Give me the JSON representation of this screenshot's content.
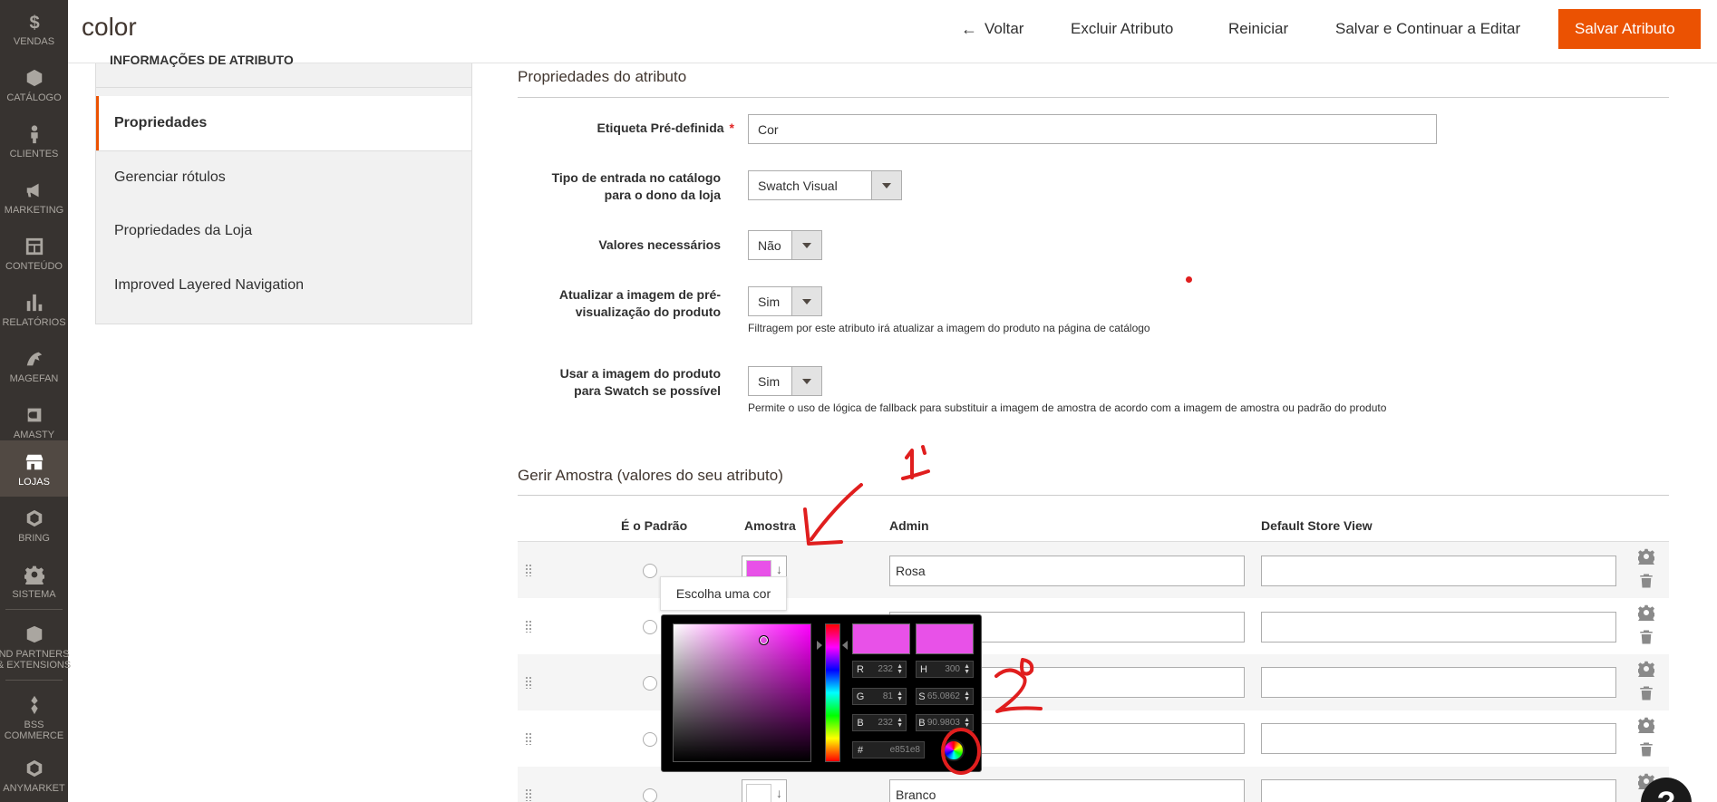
{
  "header": {
    "title": "color",
    "back_label": "Voltar",
    "delete_label": "Excluir Atributo",
    "reset_label": "Reiniciar",
    "save_continue_label": "Salvar e Continuar a Editar",
    "save_label": "Salvar Atributo"
  },
  "sidebar": {
    "items": [
      {
        "label": "VENDAS",
        "icon": "dollar-icon"
      },
      {
        "label": "CATÁLOGO",
        "icon": "cube-icon"
      },
      {
        "label": "CLIENTES",
        "icon": "person-icon"
      },
      {
        "label": "MARKETING",
        "icon": "megaphone-icon"
      },
      {
        "label": "CONTEÚDO",
        "icon": "layout-icon"
      },
      {
        "label": "RELATÓRIOS",
        "icon": "bar-chart-icon"
      },
      {
        "label": "MAGEFAN",
        "icon": "magefan-icon"
      },
      {
        "label": "AMASTY",
        "icon": "amasty-icon"
      },
      {
        "label": "LOJAS",
        "icon": "store-icon"
      },
      {
        "label": "BRING",
        "icon": "hexagon-icon"
      },
      {
        "label": "SISTEMA",
        "icon": "gear-icon"
      },
      {
        "label": "ND PARTNERS\n& EXTENSIONS",
        "icon": "box-icon"
      },
      {
        "label": "BSS\nCOMMERCE",
        "icon": "bss-icon"
      },
      {
        "label": "ANYMARKET",
        "icon": "hexagon-icon"
      }
    ],
    "active": "LOJAS"
  },
  "tabs": {
    "heading": "INFORMAÇÕES DE ATRIBUTO",
    "items": [
      "Propriedades",
      "Gerenciar rótulos",
      "Propriedades da Loja",
      "Improved Layered Navigation"
    ],
    "active": "Propriedades"
  },
  "properties": {
    "section_title": "Propriedades do atributo",
    "default_label": {
      "label": "Etiqueta Pré-definida",
      "value": "Cor"
    },
    "input_type": {
      "label_line1": "Tipo de entrada no catálogo",
      "label_line2": "para o dono da loja",
      "value": "Swatch Visual"
    },
    "required": {
      "label": "Valores necessários",
      "value": "Não"
    },
    "update_preview": {
      "label_line1": "Atualizar a imagem de pré-",
      "label_line2": "visualização do produto",
      "value": "Sim",
      "note": "Filtragem por este atributo irá atualizar a imagem do produto na página de catálogo"
    },
    "use_product_image": {
      "label_line1": "Usar a imagem do produto",
      "label_line2": "para Swatch se possível",
      "value": "Sim",
      "note": "Permite o uso de lógica de fallback para substituir a imagem de amostra de acordo com a imagem de amostra ou padrão do produto"
    }
  },
  "swatches": {
    "section_title": "Gerir Amostra (valores do seu atributo)",
    "columns": [
      "É o Padrão",
      "Amostra",
      "Admin",
      "Default Store View"
    ],
    "rows": [
      {
        "admin": "Rosa",
        "store": "",
        "color": "#e851e8"
      },
      {
        "admin": "",
        "store": "",
        "color": ""
      },
      {
        "admin": "",
        "store": "",
        "color": ""
      },
      {
        "admin": "",
        "store": "",
        "color": ""
      },
      {
        "admin": "Branco",
        "store": "",
        "color": "#ffffff"
      }
    ],
    "tooltip": "Escolha uma cor"
  },
  "color_picker": {
    "current_color": "#e851e8",
    "r": "232",
    "g": "81",
    "b": "232",
    "h": "300",
    "s": "65.0862",
    "bv": "90.9803",
    "hex": "e851e8",
    "labels": {
      "r": "R",
      "g": "G",
      "b": "B",
      "h": "H",
      "s": "S",
      "bv": "B",
      "hex": "#"
    }
  },
  "annotations": {
    "step1": "1",
    "step2": "2"
  },
  "help": {
    "label": "?"
  },
  "colors": {
    "accent": "#eb5202",
    "sidebar": "#373330",
    "annotation": "#e01e1e"
  }
}
